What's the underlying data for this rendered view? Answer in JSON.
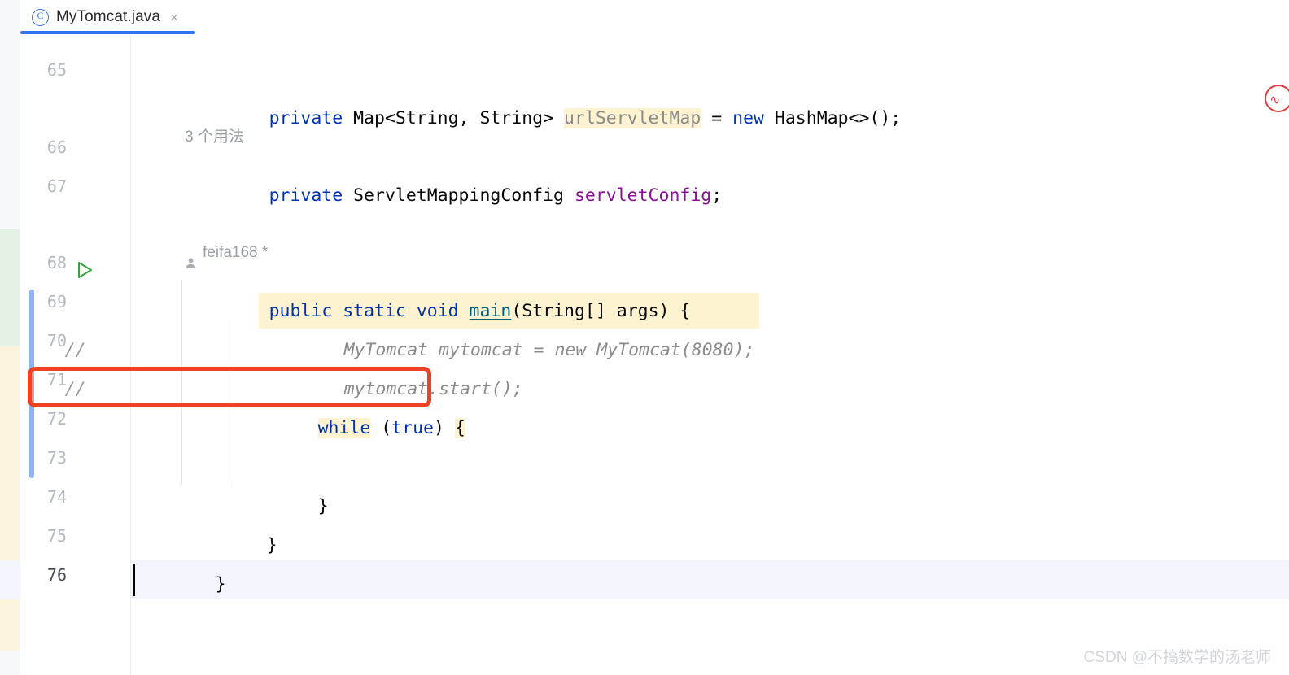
{
  "window": {
    "accent_color": "#3574f0",
    "background": "#ffffff"
  },
  "tabbar": {
    "tabs": [
      {
        "label": "MyTomcat.java",
        "icon": "java-class-icon",
        "icon_glyph": "C",
        "close_glyph": "×",
        "active": true
      }
    ]
  },
  "editor": {
    "gutter": {
      "line_numbers": [
        "65",
        "66",
        "67",
        "68",
        "69",
        "70",
        "71",
        "72",
        "73",
        "74",
        "75",
        "76"
      ],
      "current_line": "76",
      "run_marker_line": "68",
      "run_marker_icon": "run-play-icon",
      "comment_markers": [
        "//",
        "//"
      ]
    },
    "inlay_hints": [
      {
        "text": "3 个用法",
        "icon": "none"
      },
      {
        "text": "feifa168 *",
        "icon": "person-icon"
      }
    ],
    "lines": [
      {
        "number": "65",
        "tokens": [
          {
            "t": "private",
            "k": "kw"
          },
          {
            "t": " Map<String, String> ",
            "k": "plain"
          },
          {
            "t": "urlServletMap",
            "k": "hl-ident"
          },
          {
            "t": " = ",
            "k": "plain"
          },
          {
            "t": "new",
            "k": "kw"
          },
          {
            "t": " HashMap<>();",
            "k": "plain"
          }
        ]
      },
      {
        "number": "66",
        "tokens": [
          {
            "t": "private",
            "k": "kw"
          },
          {
            "t": " ServletMappingConfig ",
            "k": "plain"
          },
          {
            "t": "servletConfig",
            "k": "fld"
          },
          {
            "t": ";",
            "k": "plain"
          }
        ]
      },
      {
        "number": "67",
        "tokens": []
      },
      {
        "number": "68",
        "tokens": [
          {
            "t": "public",
            "k": "kw"
          },
          {
            "t": " ",
            "k": "plain"
          },
          {
            "t": "static",
            "k": "kw"
          },
          {
            "t": " ",
            "k": "plain"
          },
          {
            "t": "void",
            "k": "kw"
          },
          {
            "t": " ",
            "k": "plain"
          },
          {
            "t": "main",
            "k": "mth"
          },
          {
            "t": "(String[] args) {",
            "k": "plain"
          }
        ]
      },
      {
        "number": "69",
        "comment_prefix": "//",
        "tokens": [
          {
            "t": "MyTomcat mytomcat",
            "k": "comment squig-red"
          },
          {
            "t": " = ",
            "k": "comment"
          },
          {
            "t": "new MyTomcat(8080)",
            "k": "comment squig-green"
          },
          {
            "t": ";",
            "k": "comment"
          }
        ]
      },
      {
        "number": "70",
        "comment_prefix": "//",
        "tokens": [
          {
            "t": "mytomcat",
            "k": "comment squig-green"
          },
          {
            "t": ".start();",
            "k": "comment"
          }
        ]
      },
      {
        "number": "71",
        "tokens": [
          {
            "t": "while",
            "k": "kw hl-brace"
          },
          {
            "t": " (",
            "k": "plain"
          },
          {
            "t": "true",
            "k": "kw"
          },
          {
            "t": ") ",
            "k": "plain"
          },
          {
            "t": "{",
            "k": "hl-brace"
          }
        ]
      },
      {
        "number": "72",
        "tokens": []
      },
      {
        "number": "73",
        "tokens": [
          {
            "t": "}",
            "k": "plain"
          }
        ]
      },
      {
        "number": "74",
        "tokens": [
          {
            "t": "}",
            "k": "plain"
          }
        ]
      },
      {
        "number": "75",
        "tokens": [
          {
            "t": "}",
            "k": "plain"
          }
        ]
      },
      {
        "number": "76",
        "tokens": []
      }
    ],
    "annotation": {
      "kind": "red-highlight-box",
      "target_line": "71",
      "color": "#ee4323"
    },
    "vcs_markers": [
      {
        "kind": "added",
        "color": "#e4f2e6"
      },
      {
        "kind": "modified",
        "color": "#fdf4dd"
      }
    ],
    "inspection_badge": {
      "icon": "inspection-error-icon",
      "color": "#e0393a"
    }
  },
  "watermark": {
    "text": "CSDN @不搞数学的汤老师"
  }
}
